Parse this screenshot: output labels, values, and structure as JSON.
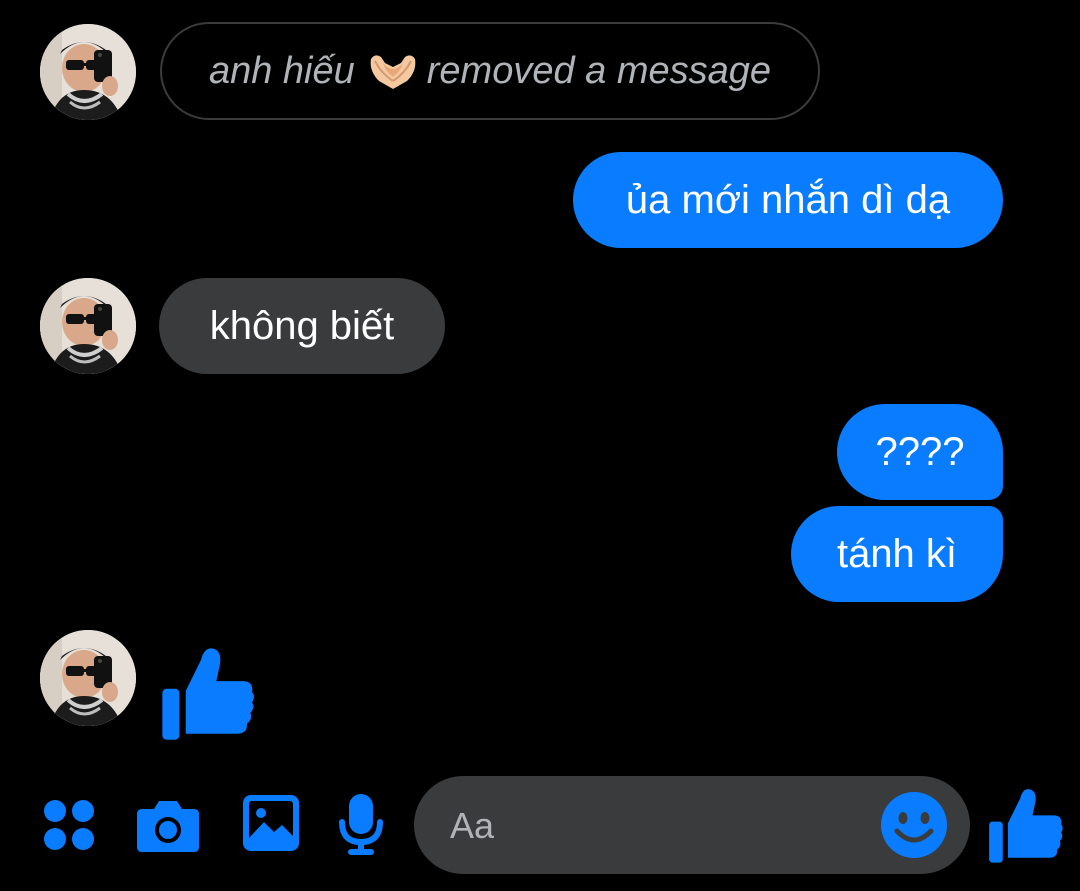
{
  "colors": {
    "background": "#000000",
    "accent": "#0a7cff",
    "incoming_bubble": "#3a3b3c",
    "system_text": "#b0b3b8"
  },
  "messages": [
    {
      "type": "system",
      "actor": "anh hiếu",
      "emoji": "heart-hands-icon",
      "action": "removed a message"
    },
    {
      "type": "outgoing",
      "text": "ủa mới nhắn dì dạ"
    },
    {
      "type": "incoming",
      "text": "không biết"
    },
    {
      "type": "outgoing",
      "text": "????"
    },
    {
      "type": "outgoing",
      "text": "tánh kì"
    },
    {
      "type": "incoming",
      "emoji": "thumbs-up-icon"
    }
  ],
  "composer": {
    "icons": [
      "grid-menu-icon",
      "camera-icon",
      "image-icon",
      "microphone-icon"
    ],
    "placeholder": "Aa",
    "value": "",
    "emoji_button": "smiley-icon",
    "send_button": "thumbs-up-icon"
  }
}
